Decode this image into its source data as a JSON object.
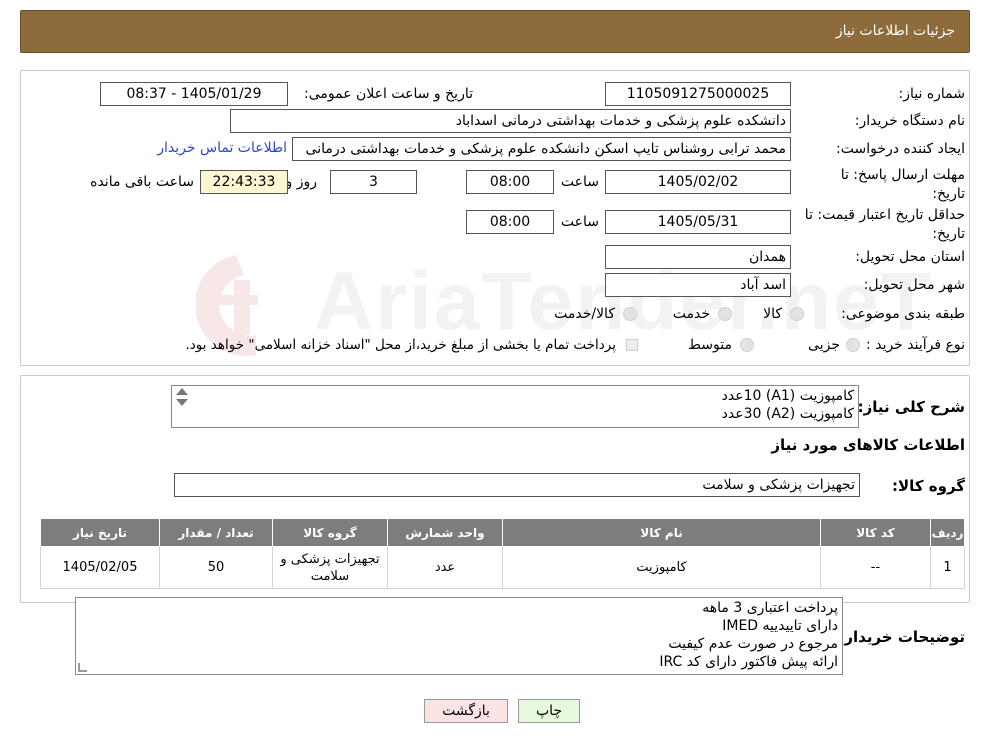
{
  "header": {
    "title": "جزئیات اطلاعات نیاز"
  },
  "form": {
    "need_number_label": "شماره نیاز:",
    "need_number": "1105091275000025",
    "announce_label": "تاریخ و ساعت اعلان عمومی:",
    "announce_value": "1405/01/29 - 08:37",
    "buyer_org_label": "نام دستگاه خریدار:",
    "buyer_org": "دانشکده علوم پزشکی و خدمات بهداشتی درمانی اسداباد",
    "requester_label": "ایجاد کننده درخواست:",
    "requester": "محمد ترابی روشناس تایپ اسکن دانشکده علوم پزشکی و خدمات بهداشتی درمانی",
    "contact_link": "اطلاعات تماس خریدار",
    "deadline_label": "مهلت ارسال پاسخ: تا تاریخ:",
    "deadline_date": "1405/02/02",
    "time_label": "ساعت",
    "deadline_time": "08:00",
    "days_value": "3",
    "days_label": "روز و",
    "remaining_time": "22:43:33",
    "remaining_label": "ساعت باقی مانده",
    "validity_label": "حداقل تاریخ اعتبار قیمت: تا تاریخ:",
    "validity_date": "1405/05/31",
    "validity_time": "08:00",
    "province_label": "استان محل تحویل:",
    "province": "همدان",
    "city_label": "شهر محل تحویل:",
    "city": "اسد آباد",
    "category_label": "طبقه بندی موضوعی:",
    "category_options": [
      "کالا",
      "خدمت",
      "کالا/خدمت"
    ],
    "process_label": "نوع فرآیند خرید :",
    "process_options": [
      "جزیی",
      "متوسط"
    ],
    "payment_note": "پرداخت تمام یا بخشی از مبلغ خرید،از محل \"اسناد خزانه اسلامی\" خواهد بود."
  },
  "description": {
    "label": "شرح کلی نیاز:",
    "lines": [
      "کامپوزیت (A1) 10عدد",
      "کامپوزیت (A2) 30عدد"
    ]
  },
  "goods": {
    "section_title": "اطلاعات کالاهای مورد نیاز",
    "group_label": "گروه کالا:",
    "group_value": "تجهیزات پزشکی و سلامت",
    "columns": [
      "ردیف",
      "کد کالا",
      "نام کالا",
      "واحد شمارش",
      "گروه کالا",
      "تعداد / مقدار",
      "تاریخ نیاز"
    ],
    "rows": [
      [
        "1",
        "--",
        "کامپوزیت",
        "عدد",
        "تجهیزات پزشکی و سلامت",
        "50",
        "1405/02/05"
      ]
    ]
  },
  "buyer_notes": {
    "label": "توضیحات خریدار:",
    "lines": [
      "پرداخت اعتباری 3 ماهه",
      "دارای تاییدییه IMED",
      "مرجوع در صورت عدم کیفیت",
      "ارائه پیش فاکتور دارای کد IRC"
    ]
  },
  "buttons": {
    "print": "چاپ",
    "back": "بازگشت"
  },
  "watermark": "AriaTender.neT",
  "colors": {
    "header_bg": "#8e6b3a",
    "table_header_bg": "#7d7d7d",
    "timer_bg": "#fbf7d2",
    "back_btn_bg": "#fbe3e3",
    "print_btn_bg": "#e7f9dd",
    "link": "#2b48cc"
  }
}
